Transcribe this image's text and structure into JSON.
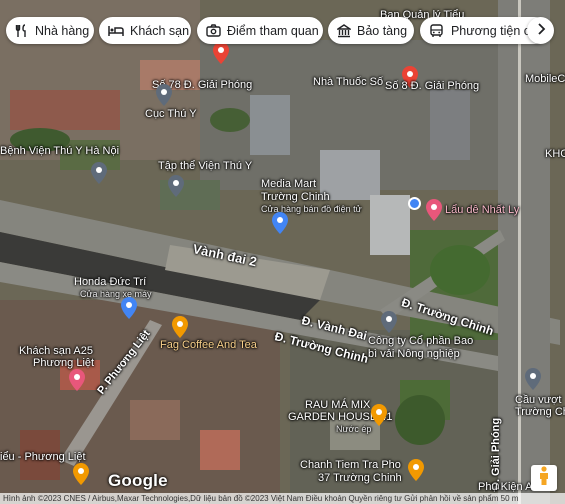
{
  "chips": [
    {
      "label": "Nhà hàng",
      "icon": "fork-knife-icon"
    },
    {
      "label": "Khách sạn",
      "icon": "bed-icon"
    },
    {
      "label": "Điểm tham quan",
      "icon": "camera-icon"
    },
    {
      "label": "Bảo tàng",
      "icon": "museum-icon"
    },
    {
      "label": "Phương tiện cô",
      "icon": "bus-icon"
    }
  ],
  "more_icon": "chevron-right-icon",
  "places": {
    "ban_quan_ly_tieu": "Ban Quản lý Tiểu",
    "n78_giai_phong": "Số 78 Đ. Giải Phóng",
    "nha_thuoc_so": "Nhà Thuốc Số",
    "n8_giai_phong": "Số 8 Đ. Giải Phóng",
    "mobile_city": "MobileCity",
    "cuc_thu_y": "Cục Thú Y",
    "benh_vien_thu_y": "Bệnh Viện Thú Y Hà Nội",
    "tap_the_vien": "Tập thể Viện Thú Y",
    "khc": "KHC",
    "media_mart": "Media Mart",
    "truong_chinh_store": "Trường Chinh",
    "media_mart_sub": "Cửa hàng bán đồ điện tử",
    "lau_de": "Lẩu dê Nhất Ly",
    "honda": "Honda Đức Trí",
    "honda_sub": "Cửa hàng xe máy",
    "fag": "Fag Coffee And Tea",
    "cong_ty": "Công ty Cổ phần Bao",
    "cong_ty_2": "bì vải Nông nghiệp",
    "khach_san": "Khách sạn A25",
    "khach_san_2": "Phương Liệt",
    "rau_ma": "RAU MÁ MIX",
    "rau_ma_2": "GARDEN HOUSE 41",
    "rau_ma_sub": "Nước ép",
    "cau_vuot": "Cầu vượt",
    "cau_vuot_2": "Trường Ch",
    "chanh": "Chanh Tiem Tra Pho",
    "chanh_2": "37 Trường Chinh",
    "bieu_so": "iểu - Phương Liệt",
    "phu_kien": "Phụ Kiện A"
  },
  "roads": {
    "vanh_dai_2": "Vành đai 2",
    "truong_chinh_1": "Đ. Trường Chinh",
    "vanh_dai": "Đ. Vành Đai",
    "truong_chinh_2": "Đ. Trường Chinh",
    "phuong_liet": "P. Phương Liệt",
    "giai_phong": "Đ. Giải Phóng"
  },
  "logo": "Google",
  "attribution": "Hình ảnh ©2023 CNES / Airbus,Maxar Technologies,Dữ liệu bản đồ ©2023     Việt Nam    Điều khoản    Quyền riêng tư    Gửi phản hồi về sản phẩm    50 m",
  "pegman_icon": "pegman-icon",
  "colors": {
    "pin_red": "#ea4335",
    "pin_gray": "#5f6b7a",
    "pin_orange": "#f29900",
    "pin_pink": "#e8577b",
    "pin_blue": "#4285f4"
  }
}
